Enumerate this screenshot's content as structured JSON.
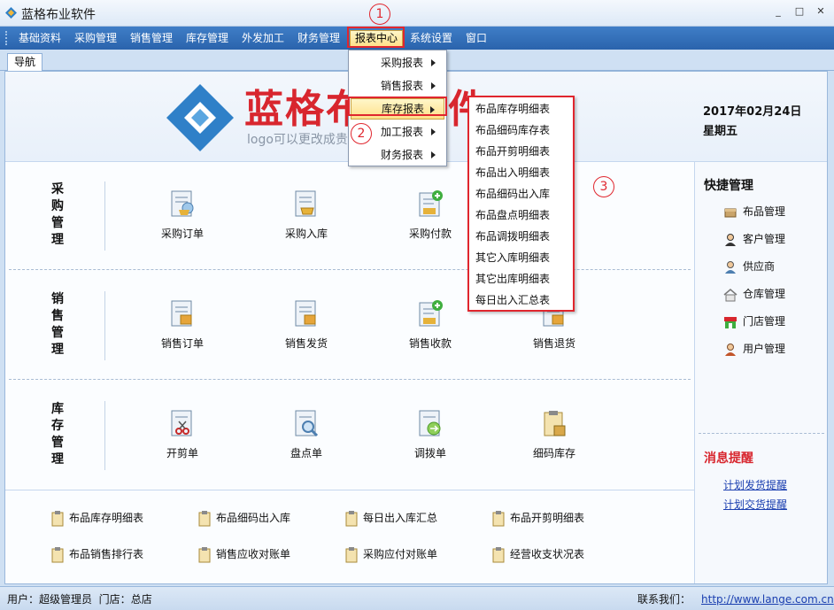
{
  "window": {
    "title": "蓝格布业软件",
    "controls": [
      "_",
      "□",
      "✕"
    ]
  },
  "menubar": {
    "items": [
      "基础资料",
      "采购管理",
      "销售管理",
      "库存管理",
      "外发加工",
      "财务管理",
      "报表中心",
      "系统设置",
      "窗口"
    ],
    "active": "报表中心"
  },
  "tabs": [
    "导航"
  ],
  "header": {
    "logo_text": "蓝格布业软件",
    "logo_sub": "logo可以更改成贵公司",
    "date": "2017年02月24日",
    "weekday": "星期五"
  },
  "sections": [
    {
      "title": [
        "采",
        "购",
        "管",
        "理"
      ],
      "items": [
        "采购订单",
        "采购入库",
        "采购付款"
      ]
    },
    {
      "title": [
        "销",
        "售",
        "管",
        "理"
      ],
      "items": [
        "销售订单",
        "销售发货",
        "销售收款",
        "销售退货"
      ]
    },
    {
      "title": [
        "库",
        "存",
        "管",
        "理"
      ],
      "items": [
        "开剪单",
        "盘点单",
        "调拨单",
        "细码库存"
      ]
    }
  ],
  "bottom_links": [
    "布品库存明细表",
    "布品细码出入库",
    "每日出入库汇总",
    "布品开剪明细表",
    "布品销售排行表",
    "销售应收对账单",
    "采购应付对账单",
    "经营收支状况表"
  ],
  "quick": {
    "title": "快捷管理",
    "items": [
      "布品管理",
      "客户管理",
      "供应商",
      "仓库管理",
      "门店管理",
      "用户管理"
    ]
  },
  "messages": {
    "title": "消息提醒",
    "links": [
      "计划发货提醒",
      "计划交货提醒"
    ]
  },
  "dropdown": {
    "items": [
      "采购报表",
      "销售报表",
      "库存报表",
      "加工报表",
      "财务报表"
    ],
    "highlighted": "库存报表"
  },
  "submenu": {
    "items": [
      "布品库存明细表",
      "布品细码库存表",
      "布品开剪明细表",
      "布品出入明细表",
      "布品细码出入库",
      "布品盘点明细表",
      "布品调拨明细表",
      "其它入库明细表",
      "其它出库明细表",
      "每日出入汇总表"
    ]
  },
  "callouts": [
    "1",
    "2",
    "3"
  ],
  "status": {
    "user_label": "用户：",
    "user": "超级管理员",
    "store_label": "门店：",
    "store": "总店",
    "contact_label": "联系我们：",
    "url": "http://www.lange.com.cn"
  },
  "colors": {
    "menubar": "#2f6db8",
    "brand_red": "#d8262e",
    "logo_blue": "#2f80c8",
    "highlight": "#ffe18a",
    "annotation": "#e0262e"
  }
}
